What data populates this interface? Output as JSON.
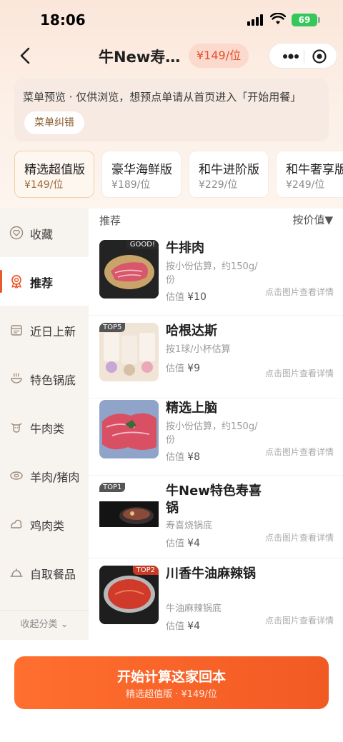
{
  "status": {
    "time": "18:06",
    "battery": "69"
  },
  "nav": {
    "title": "牛New寿…",
    "price": "¥149/位"
  },
  "notice": {
    "text": "菜单预览 · 仅供浏览，想预点单请从首页进入「开始用餐」",
    "fix_button": "菜单纠错"
  },
  "packages": [
    {
      "name": "精选超值版",
      "price": "¥149/位",
      "active": true
    },
    {
      "name": "豪华海鲜版",
      "price": "¥189/位"
    },
    {
      "name": "和牛进阶版",
      "price": "¥229/位"
    },
    {
      "name": "和牛奢享版",
      "price": "¥249/位"
    }
  ],
  "sidebar": {
    "items": [
      {
        "label": "收藏",
        "icon": "heart-icon"
      },
      {
        "label": "推荐",
        "icon": "award-icon",
        "active": true
      },
      {
        "label": "近日上新",
        "icon": "calendar-icon"
      },
      {
        "label": "特色锅底",
        "icon": "pot-icon"
      },
      {
        "label": "牛肉类",
        "icon": "cow-icon"
      },
      {
        "label": "羊肉/猪肉",
        "icon": "meat-icon"
      },
      {
        "label": "鸡肉类",
        "icon": "chicken-icon"
      },
      {
        "label": "自取餐品",
        "icon": "tray-icon"
      }
    ],
    "collapse": "收起分类 ⌄"
  },
  "list": {
    "section_title": "推荐",
    "sort_label": "按价值▼",
    "estimate_label": "估值",
    "items": [
      {
        "name": "牛排肉",
        "desc": "按小份估算，约150g/份",
        "price": "¥10",
        "detail": "点击图片查看详情",
        "tag": "GOOD!"
      },
      {
        "name": "哈根达斯",
        "desc": "按1球/小杯估算",
        "price": "¥9",
        "detail": "点击图片查看详情",
        "tag": "TOP5"
      },
      {
        "name": "精选上脑",
        "desc": "按小份估算，约150g/份",
        "price": "¥8",
        "detail": "点击图片查看详情",
        "tag": ""
      },
      {
        "name": "牛New特色寿喜锅",
        "desc": "寿喜烧锅底",
        "price": "¥4",
        "detail": "点击图片查看详情",
        "tag": "TOP1"
      },
      {
        "name": "川香牛油麻辣锅",
        "desc": "牛油麻辣锅底",
        "price": "¥4",
        "detail": "点击图片查看详情",
        "tag": "TOP2"
      }
    ]
  },
  "cta": {
    "title": "开始计算这家回本",
    "subtitle": "精选超值版 · ¥149/位"
  },
  "colors": {
    "accent": "#f25a24",
    "gold": "#9a6a3a",
    "sidebar_bg": "#f7f3ef"
  }
}
